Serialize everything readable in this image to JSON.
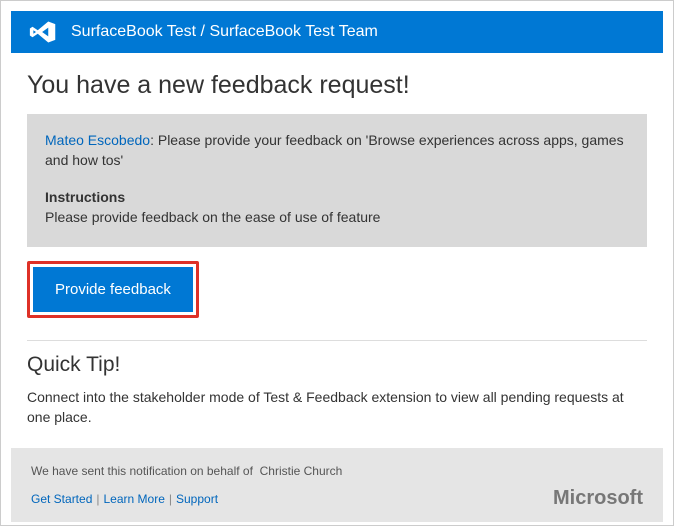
{
  "header": {
    "breadcrumb": "SurfaceBook Test / SurfaceBook Test Team"
  },
  "title": "You have a new feedback request!",
  "request": {
    "requester": "Mateo Escobedo",
    "separator": ": ",
    "message": "Please provide your feedback on 'Browse experiences across  apps, games and how tos'",
    "instructions_label": "Instructions",
    "instructions_text": "Please provide feedback on the ease of use of feature"
  },
  "button": {
    "label": "Provide feedback"
  },
  "tip": {
    "title": "Quick Tip!",
    "text": "Connect into the stakeholder mode of Test & Feedback extension to view all pending requests at one place."
  },
  "footer": {
    "sent_by_prefix": "We have sent this notification on behalf of ",
    "sender": "Christie Church",
    "links": {
      "get_started": "Get Started",
      "learn_more": "Learn More",
      "support": "Support"
    },
    "brand": "Microsoft"
  }
}
